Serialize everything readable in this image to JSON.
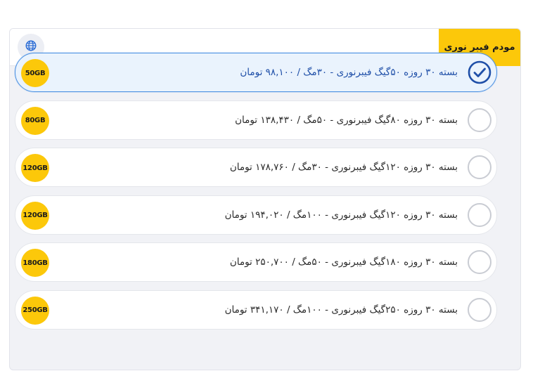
{
  "header": {
    "title": "مودم فیبر نوری",
    "globe_icon": "globe-icon"
  },
  "colors": {
    "accent_yellow": "#fcc80a",
    "selected_border": "#4a90e2",
    "selected_bg": "#eaf3fd",
    "selected_text": "#1f4fa8"
  },
  "packages": [
    {
      "label": "بسته ۳۰ روزه ۵۰گیگ فیبرنوری - ۳۰مگ / ۹۸,۱۰۰ تومان",
      "badge": "50GB",
      "selected": true
    },
    {
      "label": "بسته ۳۰ روزه ۸۰گیگ فیبرنوری - ۵۰مگ / ۱۳۸,۴۳۰ تومان",
      "badge": "80GB",
      "selected": false
    },
    {
      "label": "بسته ۳۰ روزه ۱۲۰گیگ فیبرنوری - ۳۰مگ / ۱۷۸,۷۶۰ تومان",
      "badge": "120GB",
      "selected": false
    },
    {
      "label": "بسته ۳۰ روزه ۱۲۰گیگ فیبرنوری - ۱۰۰مگ / ۱۹۴,۰۲۰ تومان",
      "badge": "120GB",
      "selected": false
    },
    {
      "label": "بسته ۳۰ روزه ۱۸۰گیگ فیبرنوری - ۵۰مگ / ۲۵۰,۷۰۰ تومان",
      "badge": "180GB",
      "selected": false
    },
    {
      "label": "بسته ۳۰ روزه ۲۵۰گیگ فیبرنوری - ۱۰۰مگ / ۳۴۱,۱۷۰ تومان",
      "badge": "250GB",
      "selected": false
    }
  ]
}
